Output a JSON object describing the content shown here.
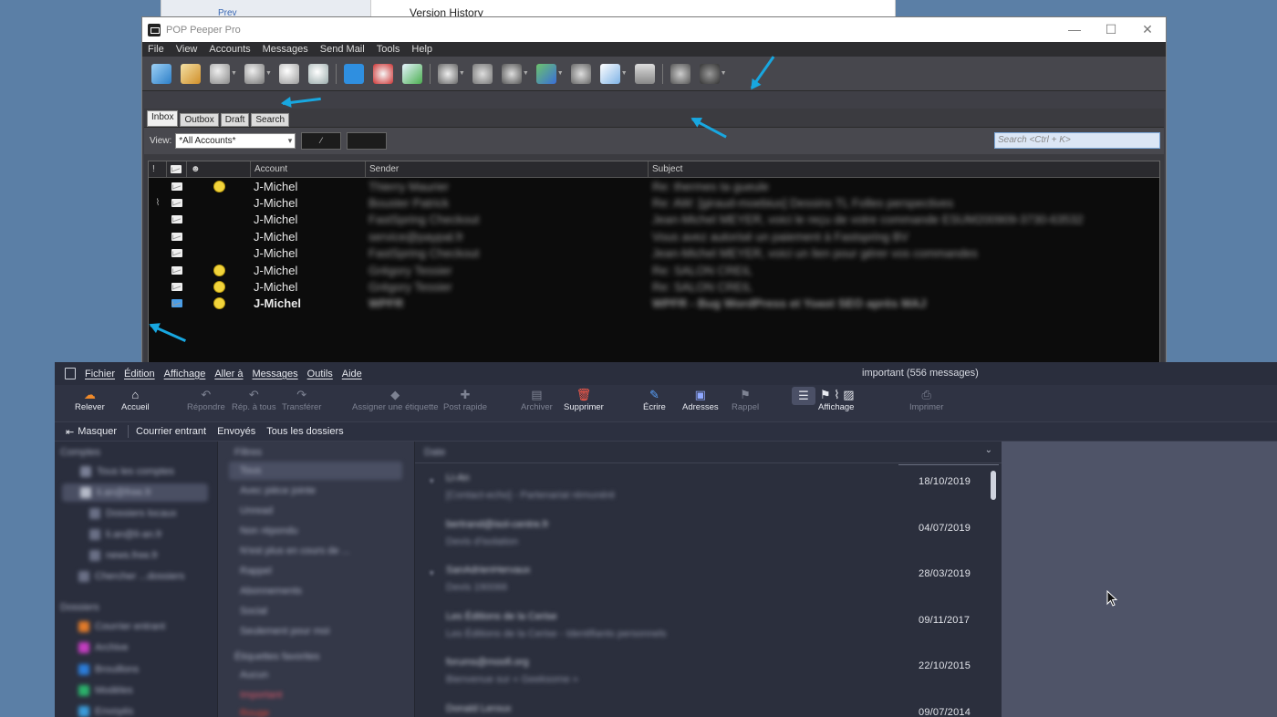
{
  "background_window": {
    "title": "Version History",
    "tab_label": "Prev"
  },
  "pop_peeper": {
    "window_title": "POP Peeper Pro",
    "window_controls": {
      "minimize": "—",
      "maximize": "☐",
      "close": "✕"
    },
    "menu": [
      "File",
      "View",
      "Accounts",
      "Messages",
      "Send Mail",
      "Tools",
      "Help"
    ],
    "tabs": [
      "Inbox",
      "Outbox",
      "Draft",
      "Search"
    ],
    "view_label": "View:",
    "view_select": "*All Accounts*",
    "search_placeholder": "Search <Ctrl + K>",
    "columns": {
      "importance": "!",
      "account": "Account",
      "sender": "Sender",
      "subject": "Subject"
    },
    "rows": [
      {
        "flag": "",
        "smiley": true,
        "account": "J-Michel",
        "sender": "Thierry Maurier",
        "subject": "Re: thermes ta gueule",
        "bold": false,
        "new": false
      },
      {
        "flag": "attachment",
        "smiley": false,
        "account": "J-Michel",
        "sender": "Bouster Patrick",
        "subject": "Re: AW: [giraud-moebius] Dessins TL Folles perspectives",
        "bold": false,
        "new": false
      },
      {
        "flag": "",
        "smiley": false,
        "account": "J-Michel",
        "sender": "FastSpring Checkout",
        "subject": "Jean-Michel MEYER, voici le reçu de votre commande ESUM200909-3730-63532",
        "bold": false,
        "new": false
      },
      {
        "flag": "",
        "smiley": false,
        "account": "J-Michel",
        "sender": "service@paypal.fr",
        "subject": "Vous avez autorisé un paiement à Fastspring BV",
        "bold": false,
        "new": false
      },
      {
        "flag": "",
        "smiley": false,
        "account": "J-Michel",
        "sender": "FastSpring Checkout",
        "subject": "Jean-Michel MEYER, voici un lien pour gérer vos commandes",
        "bold": false,
        "new": false
      },
      {
        "flag": "",
        "smiley": true,
        "account": "J-Michel",
        "sender": "Grégory Tessier",
        "subject": "Re: SALON CREIL",
        "bold": false,
        "new": false
      },
      {
        "flag": "",
        "smiley": true,
        "account": "J-Michel",
        "sender": "Grégory Tessier",
        "subject": "Re: SALON CREIL",
        "bold": false,
        "new": false
      },
      {
        "flag": "",
        "smiley": true,
        "account": "J-Michel",
        "sender": "WPFR",
        "subject": "WPFR - Bug WordPress et Yoast SEO après MAJ",
        "bold": true,
        "new": true
      }
    ]
  },
  "mail_client": {
    "menu": [
      "Fichier",
      "Édition",
      "Affichage",
      "Aller à",
      "Messages",
      "Outils",
      "Aide"
    ],
    "folder_title": "important (556 messages)",
    "toolbar": [
      {
        "label": "Relever",
        "icon": "cloud-download-icon",
        "enabled": true
      },
      {
        "label": "Accueil",
        "icon": "home-icon",
        "enabled": true
      },
      {
        "label": "Répondre",
        "icon": "reply-icon",
        "enabled": false
      },
      {
        "label": "Rép. à tous",
        "icon": "reply-all-icon",
        "enabled": false
      },
      {
        "label": "Transférer",
        "icon": "forward-icon",
        "enabled": false
      },
      {
        "label": "Assigner une étiquette",
        "icon": "tag-icon",
        "enabled": false
      },
      {
        "label": "Post rapide",
        "icon": "quick-post-icon",
        "enabled": false
      },
      {
        "label": "Archiver",
        "icon": "archive-icon",
        "enabled": false
      },
      {
        "label": "Supprimer",
        "icon": "trash-icon",
        "enabled": true
      },
      {
        "label": "Écrire",
        "icon": "pen-icon",
        "enabled": true
      },
      {
        "label": "Adresses",
        "icon": "address-book-icon",
        "enabled": true
      },
      {
        "label": "Rappel",
        "icon": "flag-icon",
        "enabled": false
      },
      {
        "label": "Affichage",
        "icon": "layout-icon",
        "enabled": true
      },
      {
        "label": "Imprimer",
        "icon": "printer-icon",
        "enabled": false
      }
    ],
    "quickbar": {
      "hide": "Masquer",
      "links": [
        "Courrier entrant",
        "Envoyés",
        "Tous les dossiers"
      ]
    },
    "folders": {
      "accounts_heading": "Comptes",
      "accounts": [
        "Tous les comptes",
        "li.an@free.fr",
        "Dossiers locaux",
        "li.an@li-an.fr",
        "news.free.fr",
        "Chercher ...dossiers"
      ],
      "folders_heading": "Dossiers",
      "folder_items": [
        "Courrier entrant",
        "Archive",
        "Brouillons",
        "Modèles",
        "Envoyés"
      ],
      "folder_colors": [
        "#e07a2a",
        "#c23dbf",
        "#2b7cd8",
        "#2bb06a",
        "#3a9ad8"
      ]
    },
    "smart_filters": {
      "heading": "Filtres",
      "items": [
        "Tous",
        "Avec pièce jointe",
        "Unread",
        "Non répondu",
        "N'est plus en cours de ...",
        "Rappel",
        "Abonnements",
        "Social",
        "Seulement pour moi"
      ],
      "labels_heading": "Étiquettes favorites",
      "labels": [
        "Aucun",
        "Important",
        "Rouge"
      ]
    },
    "message_list": {
      "sort_column": "Date",
      "messages": [
        {
          "from": "Li-An",
          "subject": "[Contact-echo] - Partenariat rémunéré",
          "date": "18/10/2019",
          "thread": true
        },
        {
          "from": "bertrand@isol-centre.fr",
          "subject": "Devis d'isolation",
          "date": "04/07/2019",
          "thread": false
        },
        {
          "from": "SanAdrienHervaux",
          "subject": "Devis 190066",
          "date": "28/03/2019",
          "thread": true
        },
        {
          "from": "Les Éditions de la Cerise",
          "subject": "Les Éditions de la Cerise - Identifiants personnels",
          "date": "09/11/2017",
          "thread": false
        },
        {
          "from": "forums@moofi.org",
          "subject": "Bienvenue sur « Geeksome »",
          "date": "22/10/2015",
          "thread": false
        },
        {
          "from": "Donald Leroux",
          "subject": "",
          "date": "09/07/2014",
          "thread": false
        }
      ]
    }
  },
  "colors": {
    "desktop": "#5b7fa6",
    "annotation_arrow": "#18a7e0",
    "accent": "#4a9ee8"
  }
}
